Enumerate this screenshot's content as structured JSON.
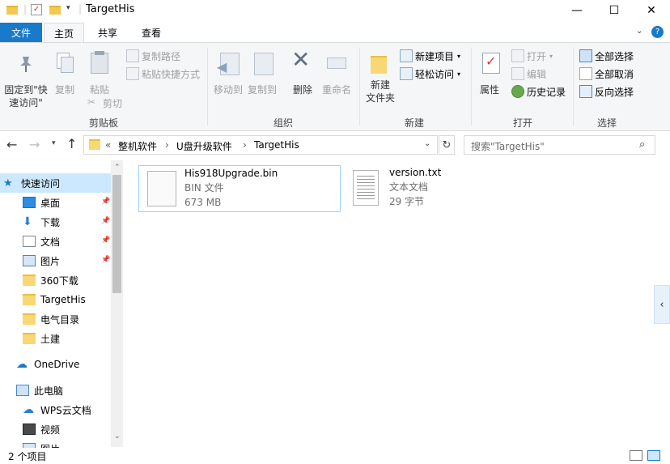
{
  "window": {
    "title": "TargetHis",
    "minimize_glyph": "—",
    "maximize_glyph": "☐",
    "close_glyph": "✕"
  },
  "ribbon_tabs": {
    "file": "文件",
    "home": "主页",
    "share": "共享",
    "view": "查看"
  },
  "ribbon": {
    "clipboard": {
      "label": "剪贴板",
      "pin": "固定到\"快\n速访问\"",
      "copy": "复制",
      "paste": "粘贴",
      "copy_path": "复制路径",
      "paste_shortcut": "粘贴快捷方式",
      "cut": "剪切"
    },
    "organize": {
      "label": "组织",
      "move_to": "移动到",
      "copy_to": "复制到",
      "delete": "删除",
      "rename": "重命名"
    },
    "new": {
      "label": "新建",
      "new_folder": "新建\n文件夹",
      "new_item": "新建项目",
      "easy_access": "轻松访问"
    },
    "open": {
      "label": "打开",
      "properties": "属性",
      "open": "打开",
      "edit": "编辑",
      "history": "历史记录"
    },
    "select": {
      "label": "选择",
      "select_all": "全部选择",
      "select_none": "全部取消",
      "invert": "反向选择"
    }
  },
  "address": {
    "prefix": "«",
    "crumbs": [
      "整机软件",
      "U盘升级软件",
      "TargetHis"
    ],
    "separator": "›",
    "search_placeholder": "搜索\"TargetHis\""
  },
  "nav_pane": {
    "quick_access": "快速访问",
    "items": [
      {
        "label": "桌面",
        "pinned": true,
        "icon": "desktop-icon"
      },
      {
        "label": "下载",
        "pinned": true,
        "icon": "download-icon"
      },
      {
        "label": "文档",
        "pinned": true,
        "icon": "documents-icon"
      },
      {
        "label": "图片",
        "pinned": true,
        "icon": "pictures-icon"
      },
      {
        "label": "360下载",
        "pinned": false,
        "icon": "folder-icon"
      },
      {
        "label": "TargetHis",
        "pinned": false,
        "icon": "folder-icon"
      },
      {
        "label": "电气目录",
        "pinned": false,
        "icon": "folder-icon"
      },
      {
        "label": "土建",
        "pinned": false,
        "icon": "folder-icon"
      }
    ],
    "onedrive": "OneDrive",
    "this_pc": "此电脑",
    "pc_items": [
      {
        "label": "WPS云文档",
        "icon": "wps-cloud-icon"
      },
      {
        "label": "视频",
        "icon": "videos-icon"
      },
      {
        "label": "图片",
        "icon": "pictures-icon"
      }
    ]
  },
  "files": [
    {
      "name": "His918Upgrade.bin",
      "type": "BIN 文件",
      "size": "673 MB",
      "selected": true
    },
    {
      "name": "version.txt",
      "type": "文本文档",
      "size": "29 字节",
      "selected": false
    }
  ],
  "status": {
    "count": "2 个项目"
  },
  "colors": {
    "accent": "#1979ca",
    "folder": "#f8d775",
    "selection_border": "#99d1ff"
  }
}
